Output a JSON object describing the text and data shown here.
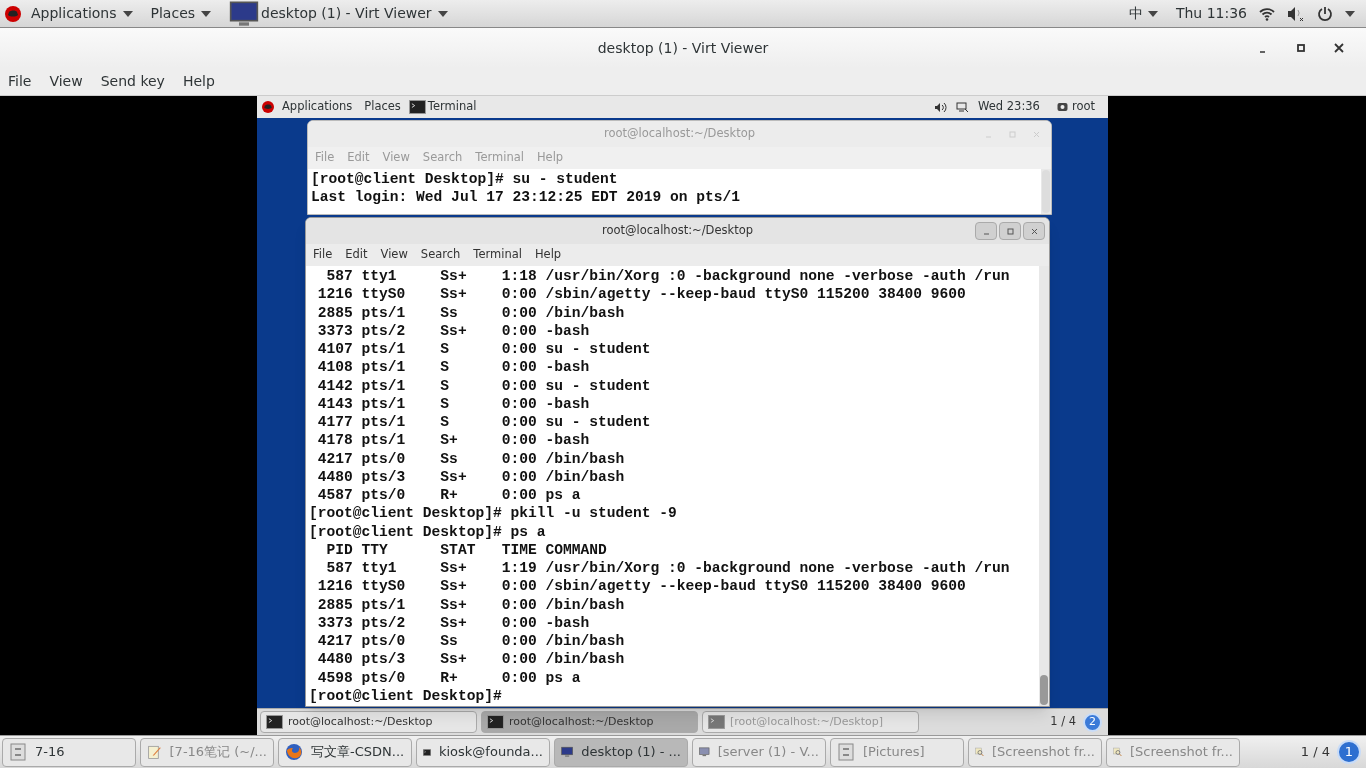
{
  "top_bar": {
    "menus": [
      "Applications",
      "Places"
    ],
    "active_app": "desktop (1) - Virt Viewer",
    "input_method": "中",
    "clock": "Thu 11:36"
  },
  "window": {
    "title": "desktop (1) - Virt Viewer",
    "menu": [
      "File",
      "View",
      "Send key",
      "Help"
    ]
  },
  "guest": {
    "top_bar": {
      "menus": [
        "Applications",
        "Places"
      ],
      "active_app": "Terminal",
      "clock": "Wed 23:36",
      "user": "root"
    },
    "terminals": [
      {
        "title": "root@localhost:~/Desktop",
        "focused": false,
        "menu": [
          "File",
          "Edit",
          "View",
          "Search",
          "Terminal",
          "Help"
        ],
        "lines": [
          "[root@client Desktop]# su - student",
          "Last login: Wed Jul 17 23:12:25 EDT 2019 on pts/1"
        ]
      },
      {
        "title": "root@localhost:~/Desktop",
        "focused": true,
        "menu": [
          "File",
          "Edit",
          "View",
          "Search",
          "Terminal",
          "Help"
        ],
        "lines": [
          "  587 tty1     Ss+    1:18 /usr/bin/Xorg :0 -background none -verbose -auth /run",
          " 1216 ttyS0    Ss+    0:00 /sbin/agetty --keep-baud ttyS0 115200 38400 9600",
          " 2885 pts/1    Ss     0:00 /bin/bash",
          " 3373 pts/2    Ss+    0:00 -bash",
          " 4107 pts/1    S      0:00 su - student",
          " 4108 pts/1    S      0:00 -bash",
          " 4142 pts/1    S      0:00 su - student",
          " 4143 pts/1    S      0:00 -bash",
          " 4177 pts/1    S      0:00 su - student",
          " 4178 pts/1    S+     0:00 -bash",
          " 4217 pts/0    Ss     0:00 /bin/bash",
          " 4480 pts/3    Ss+    0:00 /bin/bash",
          " 4587 pts/0    R+     0:00 ps a",
          "[root@client Desktop]# pkill -u student -9",
          "[root@client Desktop]# ps a",
          "  PID TTY      STAT   TIME COMMAND",
          "  587 tty1     Ss+    1:19 /usr/bin/Xorg :0 -background none -verbose -auth /run",
          " 1216 ttyS0    Ss+    0:00 /sbin/agetty --keep-baud ttyS0 115200 38400 9600",
          " 2885 pts/1    Ss+    0:00 /bin/bash",
          " 3373 pts/2    Ss+    0:00 -bash",
          " 4217 pts/0    Ss     0:00 /bin/bash",
          " 4480 pts/3    Ss+    0:00 /bin/bash",
          " 4598 pts/0    R+     0:00 ps a",
          "[root@client Desktop]# "
        ]
      }
    ],
    "taskbar": {
      "items": [
        {
          "label": "root@localhost:~/Desktop",
          "selected": false,
          "minimized": false
        },
        {
          "label": "root@localhost:~/Desktop",
          "selected": true,
          "minimized": false
        },
        {
          "label": "[root@localhost:~/Desktop]",
          "selected": false,
          "minimized": true
        }
      ],
      "pager": "1 / 4",
      "badge": "2"
    }
  },
  "taskbar": {
    "items": [
      {
        "kind": "files",
        "label": "7-16",
        "selected": false,
        "minimized": false
      },
      {
        "kind": "editor",
        "label": "[7-16笔记 (~/...",
        "selected": false,
        "minimized": true
      },
      {
        "kind": "browser",
        "label": "写文章-CSDN...",
        "selected": false,
        "minimized": false
      },
      {
        "kind": "terminal",
        "label": "kiosk@founda...",
        "selected": false,
        "minimized": false
      },
      {
        "kind": "monitor",
        "label": "desktop (1) - ...",
        "selected": true,
        "minimized": false
      },
      {
        "kind": "monitor",
        "label": "[server (1) - V...",
        "selected": false,
        "minimized": true
      },
      {
        "kind": "files",
        "label": "[Pictures]",
        "selected": false,
        "minimized": true
      },
      {
        "kind": "screenshot",
        "label": "[Screenshot fr...",
        "selected": false,
        "minimized": true
      },
      {
        "kind": "screenshot",
        "label": "[Screenshot fr...",
        "selected": false,
        "minimized": true
      }
    ],
    "pager": "1 / 4",
    "badge": "1"
  }
}
